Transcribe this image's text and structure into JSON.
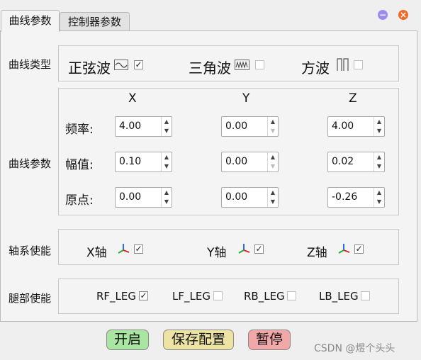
{
  "tabs": [
    {
      "label": "曲线参数"
    },
    {
      "label": "控制器参数"
    }
  ],
  "window": {
    "minimize_glyph": "−",
    "close_glyph": "×"
  },
  "curve_type": {
    "label": "曲线类型",
    "options": [
      {
        "label": "正弦波",
        "icon": "sine-wave-icon",
        "checked": true
      },
      {
        "label": "三角波",
        "icon": "triangle-wave-icon",
        "checked": false
      },
      {
        "label": "方波",
        "icon": "square-wave-icon",
        "checked": false
      }
    ]
  },
  "curve_params": {
    "label": "曲线参数",
    "headers": [
      "X",
      "Y",
      "Z"
    ],
    "rows": [
      {
        "label": "频率:",
        "values": [
          "4.00",
          "0.00",
          "4.00"
        ]
      },
      {
        "label": "幅值:",
        "values": [
          "0.10",
          "0.00",
          "0.02"
        ]
      },
      {
        "label": "原点:",
        "values": [
          "0.00",
          "0.00",
          "-0.26"
        ]
      }
    ]
  },
  "axis_enable": {
    "label": "轴系使能",
    "axes": [
      {
        "label": "X轴",
        "checked": true
      },
      {
        "label": "Y轴",
        "checked": true
      },
      {
        "label": "Z轴",
        "checked": true
      }
    ]
  },
  "leg_enable": {
    "label": "腿部使能",
    "legs": [
      {
        "label": "RF_LEG",
        "checked": true
      },
      {
        "label": "LF_LEG",
        "checked": false
      },
      {
        "label": "RB_LEG",
        "checked": false
      },
      {
        "label": "LB_LEG",
        "checked": false
      }
    ]
  },
  "buttons": {
    "start": {
      "label": "开启",
      "color": "#a8e6a1"
    },
    "save": {
      "label": "保存配置",
      "color": "#ede4a3"
    },
    "pause": {
      "label": "暂停",
      "color": "#f2a8a8"
    }
  },
  "watermark": "CSDN @煜个头头",
  "colors": {
    "minimize": "#9b8cf0",
    "close": "#f06a2a"
  }
}
